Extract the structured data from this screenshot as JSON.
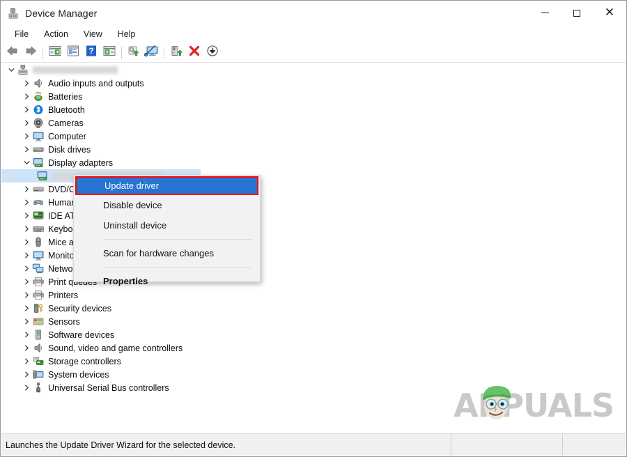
{
  "window": {
    "title": "Device Manager",
    "icon": "device-manager-icon",
    "minimize_label": "—",
    "maximize_label": "□",
    "close_label": "✕"
  },
  "menubar": {
    "items": [
      {
        "label": "File"
      },
      {
        "label": "Action"
      },
      {
        "label": "View"
      },
      {
        "label": "Help"
      }
    ]
  },
  "toolbar": {
    "buttons": [
      {
        "name": "back-icon",
        "title": "Back"
      },
      {
        "name": "forward-icon",
        "title": "Forward"
      },
      {
        "name": "separator",
        "title": ""
      },
      {
        "name": "show-hide-console-tree-icon",
        "title": "Show/Hide Console Tree"
      },
      {
        "name": "properties-icon",
        "title": "Properties"
      },
      {
        "name": "help-icon",
        "title": "Help"
      },
      {
        "name": "view-details-icon",
        "title": "View"
      },
      {
        "name": "separator",
        "title": ""
      },
      {
        "name": "update-driver-icon",
        "title": "Update Driver Software"
      },
      {
        "name": "scan-for-hardware-changes-icon",
        "title": "Scan for hardware changes"
      },
      {
        "name": "separator",
        "title": ""
      },
      {
        "name": "enable-device-icon",
        "title": "Enable device"
      },
      {
        "name": "uninstall-device-icon",
        "title": "Uninstall device"
      },
      {
        "name": "disable-device-icon",
        "title": "Disable device"
      }
    ]
  },
  "tree": {
    "root": {
      "label": "",
      "redacted": true,
      "redacted_width": 122,
      "expanded": true,
      "icon": "computer-root-icon"
    },
    "items": [
      {
        "label": "Audio inputs and outputs",
        "icon": "speaker-icon",
        "expanded": false,
        "indent": 1
      },
      {
        "label": "Batteries",
        "icon": "battery-icon",
        "expanded": false,
        "indent": 1
      },
      {
        "label": "Bluetooth",
        "icon": "bluetooth-icon",
        "expanded": false,
        "indent": 1
      },
      {
        "label": "Cameras",
        "icon": "camera-icon",
        "expanded": false,
        "indent": 1
      },
      {
        "label": "Computer",
        "icon": "monitor-icon",
        "expanded": false,
        "indent": 1
      },
      {
        "label": "Disk drives",
        "icon": "disk-drive-icon",
        "expanded": false,
        "indent": 1
      },
      {
        "label": "Display adapters",
        "icon": "display-adapter-icon",
        "expanded": true,
        "indent": 1
      },
      {
        "label": "",
        "icon": "display-adapter-child-icon",
        "expanded": null,
        "indent": 2,
        "redacted": true,
        "redacted_width": 160,
        "selected": true
      },
      {
        "label": "DVD/CD-ROM drives",
        "icon": "dvd-drive-icon",
        "expanded": false,
        "indent": 1
      },
      {
        "label": "Human Interface Devices",
        "icon": "hid-icon",
        "expanded": false,
        "indent": 1
      },
      {
        "label": "IDE ATA/ATAPI controllers",
        "icon": "ide-controller-icon",
        "expanded": false,
        "indent": 1
      },
      {
        "label": "Keyboards",
        "icon": "keyboard-icon",
        "expanded": false,
        "indent": 1
      },
      {
        "label": "Mice and other pointing devices",
        "icon": "mouse-icon",
        "expanded": false,
        "indent": 1
      },
      {
        "label": "Monitors",
        "icon": "monitor-icon",
        "expanded": false,
        "indent": 1
      },
      {
        "label": "Network adapters",
        "icon": "network-adapter-icon",
        "expanded": false,
        "indent": 1
      },
      {
        "label": "Print queues",
        "icon": "printer-icon",
        "expanded": false,
        "indent": 1
      },
      {
        "label": "Printers",
        "icon": "printer-icon",
        "expanded": false,
        "indent": 1
      },
      {
        "label": "Security devices",
        "icon": "security-device-icon",
        "expanded": false,
        "indent": 1
      },
      {
        "label": "Sensors",
        "icon": "sensor-icon",
        "expanded": false,
        "indent": 1
      },
      {
        "label": "Software devices",
        "icon": "software-device-icon",
        "expanded": false,
        "indent": 1
      },
      {
        "label": "Sound, video and game controllers",
        "icon": "sound-controller-icon",
        "expanded": false,
        "indent": 1
      },
      {
        "label": "Storage controllers",
        "icon": "storage-controller-icon",
        "expanded": false,
        "indent": 1
      },
      {
        "label": "System devices",
        "icon": "system-device-icon",
        "expanded": false,
        "indent": 1
      },
      {
        "label": "Universal Serial Bus controllers",
        "icon": "usb-controller-icon",
        "expanded": false,
        "indent": 1
      }
    ]
  },
  "context_menu": {
    "items": [
      {
        "label": "Update driver",
        "highlighted": true,
        "bold": false
      },
      {
        "label": "Disable device",
        "highlighted": false,
        "bold": false
      },
      {
        "label": "Uninstall device",
        "highlighted": false,
        "bold": false
      },
      {
        "separator": true
      },
      {
        "label": "Scan for hardware changes",
        "highlighted": false,
        "bold": false
      },
      {
        "separator": true
      },
      {
        "label": "Properties",
        "highlighted": false,
        "bold": true
      }
    ]
  },
  "statusbar": {
    "message": "Launches the Update Driver Wizard for the selected device.",
    "panel2": "",
    "panel3": ""
  },
  "watermark": {
    "text": "APPUALS"
  },
  "colors": {
    "highlight_blue": "#2874d0",
    "highlight_border_red": "#ff0000",
    "selection_blue": "#cde3f7",
    "window_bg": "#ffffff",
    "menu_bg": "#f2f2f2",
    "status_bg": "#f0f0f0",
    "watermark_gray": "#c9c9c9"
  }
}
